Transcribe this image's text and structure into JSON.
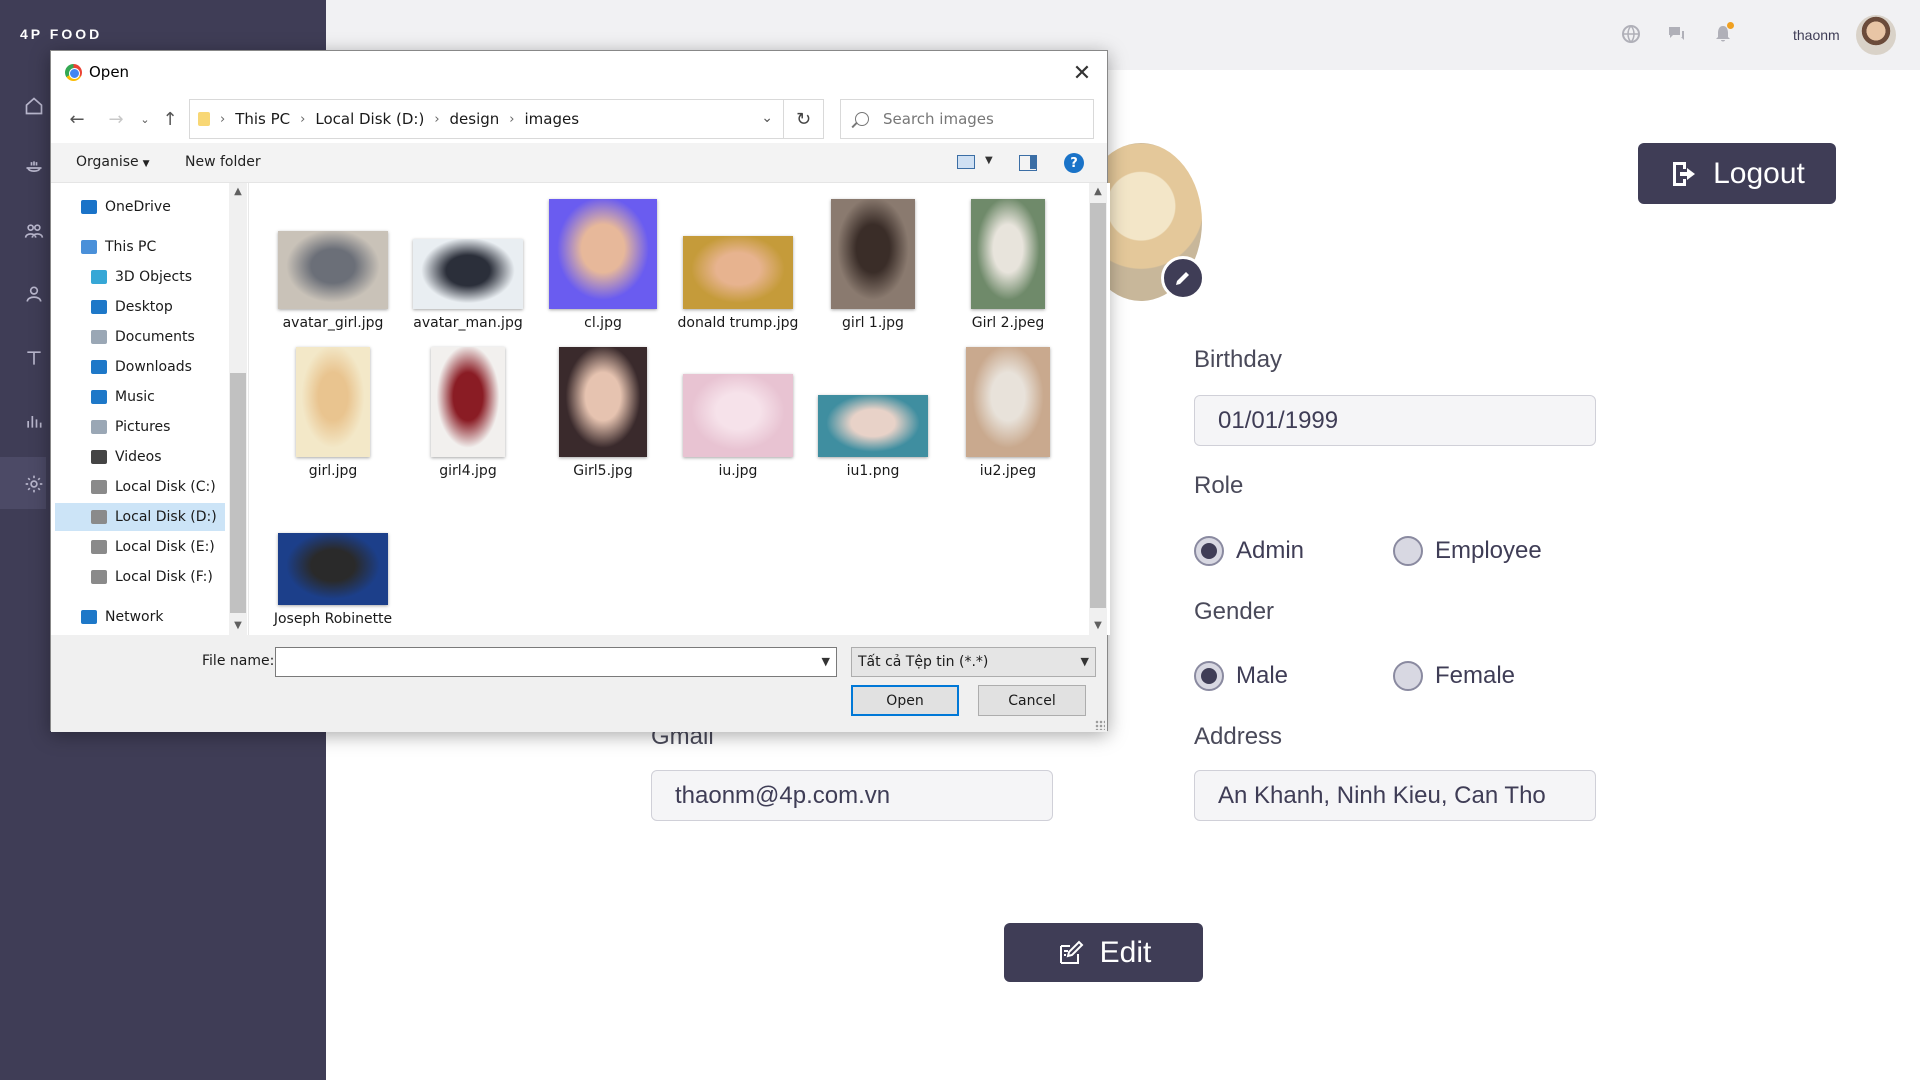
{
  "app": {
    "brand": "4P FOOD",
    "username": "thaonm"
  },
  "sidebar": {
    "icons": [
      "home-icon",
      "food-icon",
      "users-icon",
      "user-icon",
      "text-icon",
      "chart-icon",
      "settings-icon"
    ],
    "active": "settings-icon"
  },
  "topbar": {
    "icons": [
      "globe-icon",
      "chat-icon",
      "bell-icon"
    ]
  },
  "profile": {
    "logout_label": "Logout",
    "edit_label": "Edit",
    "birthday_label": "Birthday",
    "birthday_value": "01/01/1999",
    "role_label": "Role",
    "role_options": [
      "Admin",
      "Employee"
    ],
    "role_selected": "Admin",
    "gender_label": "Gender",
    "gender_options": [
      "Male",
      "Female"
    ],
    "gender_selected": "Male",
    "gmail_label": "Gmail",
    "gmail_value": "thaonm@4p.com.vn",
    "address_label": "Address",
    "address_value": "An Khanh, Ninh Kieu, Can Tho"
  },
  "dialog": {
    "title": "Open",
    "path": [
      "This PC",
      "Local Disk (D:)",
      "design",
      "images"
    ],
    "search_placeholder": "Search images",
    "organise_label": "Organise",
    "new_folder_label": "New folder",
    "nav_items": [
      {
        "label": "OneDrive",
        "icon": "onedrive-icon",
        "color": "#1a73c8"
      },
      {
        "label": "This PC",
        "icon": "pc-icon",
        "color": "#4a90d9"
      },
      {
        "label": "3D Objects",
        "icon": "3d-objects-icon",
        "color": "#36a7d6"
      },
      {
        "label": "Desktop",
        "icon": "desktop-icon",
        "color": "#1e78c8"
      },
      {
        "label": "Documents",
        "icon": "documents-icon",
        "color": "#9aa7b5"
      },
      {
        "label": "Downloads",
        "icon": "downloads-icon",
        "color": "#1e78c8"
      },
      {
        "label": "Music",
        "icon": "music-icon",
        "color": "#1e78c8"
      },
      {
        "label": "Pictures",
        "icon": "pictures-icon",
        "color": "#9aa7b5"
      },
      {
        "label": "Videos",
        "icon": "videos-icon",
        "color": "#444"
      },
      {
        "label": "Local Disk (C:)",
        "icon": "disk-c-icon",
        "color": "#8a8a8a"
      },
      {
        "label": "Local Disk (D:)",
        "icon": "disk-d-icon",
        "color": "#8a8a8a"
      },
      {
        "label": "Local Disk (E:)",
        "icon": "disk-e-icon",
        "color": "#8a8a8a"
      },
      {
        "label": "Local Disk (F:)",
        "icon": "disk-f-icon",
        "color": "#8a8a8a"
      },
      {
        "label": "Network",
        "icon": "network-icon",
        "color": "#1e78c8"
      }
    ],
    "selected_nav": "Local Disk (D:)",
    "files": [
      {
        "name": "avatar_girl.jpg",
        "colors": [
          "#c9c2b8",
          "#6b6f78"
        ]
      },
      {
        "name": "avatar_man.jpg",
        "colors": [
          "#e9eef2",
          "#2b2f3a"
        ]
      },
      {
        "name": "cl.jpg",
        "colors": [
          "#6a5cf0",
          "#e7b89a"
        ]
      },
      {
        "name": "donald trump.jpg",
        "colors": [
          "#c59b3a",
          "#e7b38f"
        ]
      },
      {
        "name": "girl 1.jpg",
        "colors": [
          "#8a7a6f",
          "#3a2d28"
        ]
      },
      {
        "name": "Girl 2.jpeg",
        "colors": [
          "#6f8a6a",
          "#e8e4dc"
        ]
      },
      {
        "name": "girl.jpg",
        "colors": [
          "#f3e8c8",
          "#e9c48f"
        ]
      },
      {
        "name": "girl4.jpg",
        "colors": [
          "#f2f0ee",
          "#8a1c24"
        ]
      },
      {
        "name": "Girl5.jpg",
        "colors": [
          "#3a2a2c",
          "#e6c3b0"
        ]
      },
      {
        "name": "iu.jpg",
        "colors": [
          "#e8c3d2",
          "#f6e2ea"
        ]
      },
      {
        "name": "iu1.png",
        "colors": [
          "#3f8ea0",
          "#e8d2c8"
        ]
      },
      {
        "name": "iu2.jpeg",
        "colors": [
          "#c9a98e",
          "#e8e2da"
        ]
      },
      {
        "name": "Joseph Robinette",
        "colors": [
          "#1c3f8a",
          "#2a2a2a"
        ]
      }
    ],
    "file_name_label": "File name:",
    "file_name_value": "",
    "file_type_value": "Tất cả Tệp tin (*.*)",
    "open_label": "Open",
    "cancel_label": "Cancel"
  }
}
